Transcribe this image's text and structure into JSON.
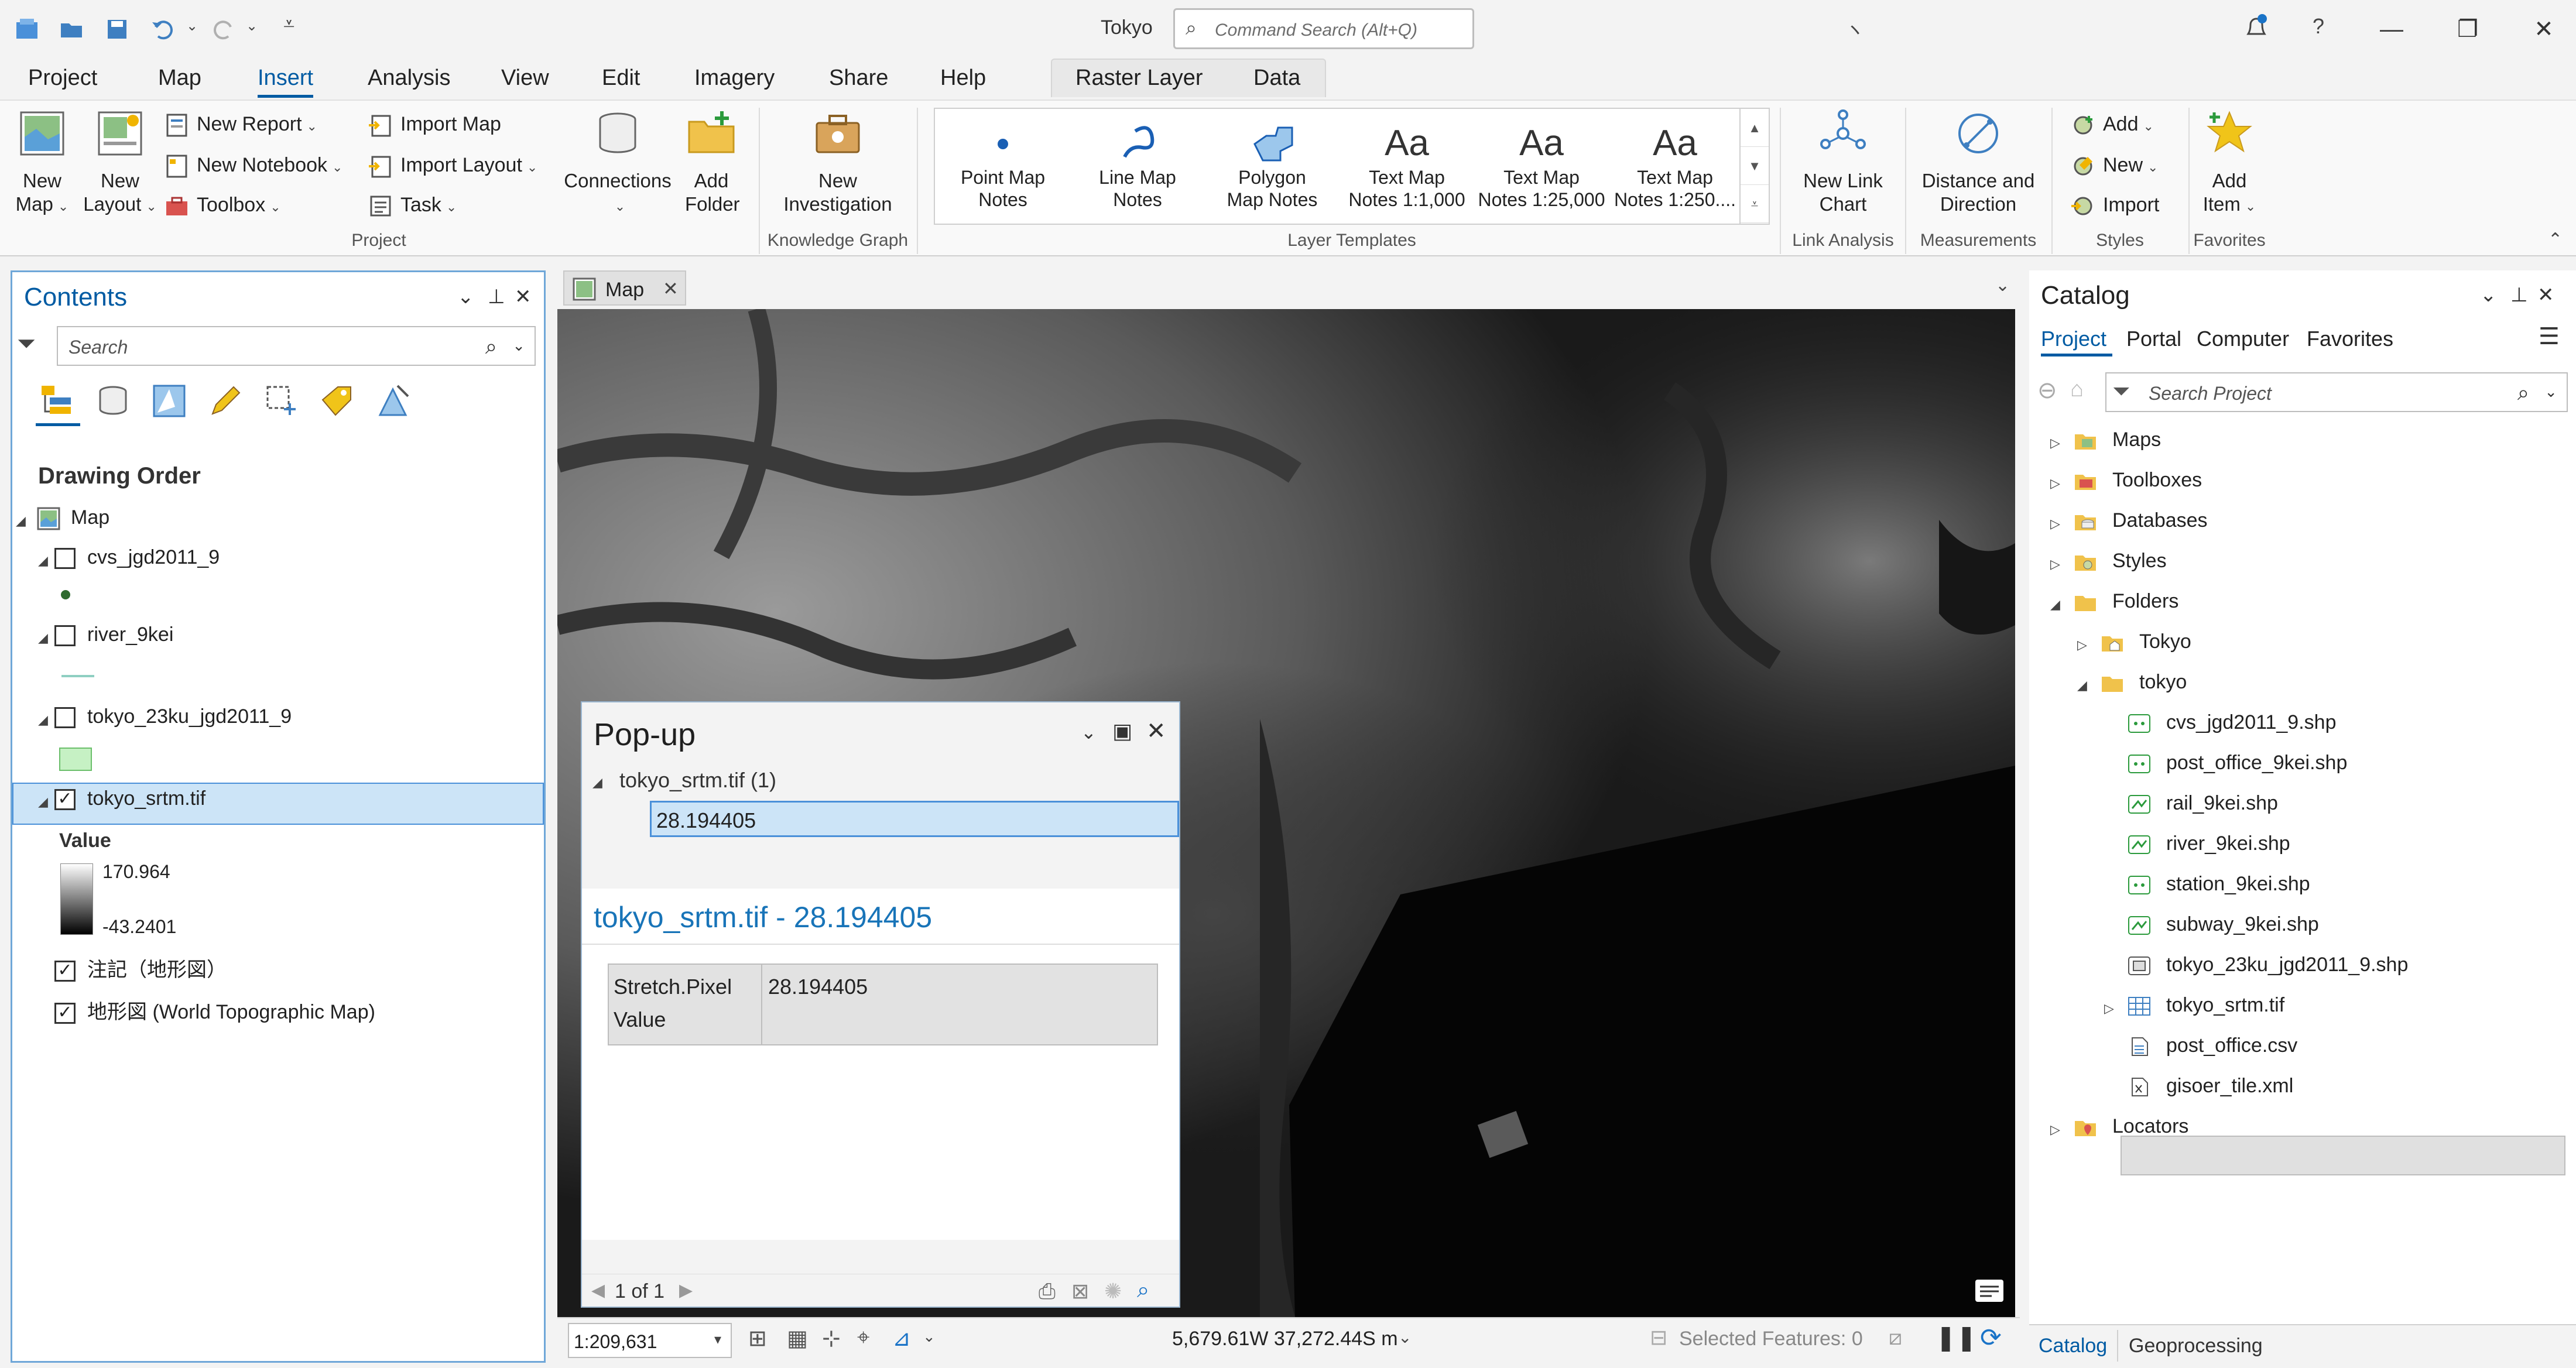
{
  "app": {
    "title": "Tokyo",
    "command_search_placeholder": "Command Search (Alt+Q)",
    "win_minimize": "—",
    "win_restore": "❐",
    "win_close": "✕",
    "title_glyph": "ヽ"
  },
  "ribbon_tabs": [
    "Project",
    "Map",
    "Insert",
    "Analysis",
    "View",
    "Edit",
    "Imagery",
    "Share",
    "Help"
  ],
  "ribbon_active_tab": "Insert",
  "context_tabs": [
    "Raster Layer",
    "Data"
  ],
  "ribbon": {
    "project": {
      "label": "Project",
      "new_map": [
        "New",
        "Map"
      ],
      "new_layout": [
        "New",
        "Layout"
      ],
      "new_report": "New Report",
      "new_notebook": "New Notebook",
      "toolbox": "Toolbox",
      "import_map": "Import Map",
      "import_layout": "Import Layout",
      "task": "Task",
      "connections": "Connections",
      "add_folder": [
        "Add",
        "Folder"
      ]
    },
    "knowledge_graph": {
      "label": "Knowledge Graph",
      "new_investigation": [
        "New",
        "Investigation"
      ]
    },
    "layer_templates": {
      "label": "Layer Templates",
      "items": [
        [
          "Point Map",
          "Notes"
        ],
        [
          "Line Map",
          "Notes"
        ],
        [
          "Polygon",
          "Map Notes"
        ],
        [
          "Text Map",
          "Notes 1:1,000"
        ],
        [
          "Text Map",
          "Notes 1:25,000"
        ],
        [
          "Text Map",
          "Notes 1:250...."
        ]
      ],
      "text_glyph": "Aa"
    },
    "link_analysis": {
      "label": "Link Analysis",
      "new_link_chart": [
        "New Link",
        "Chart"
      ]
    },
    "measurements": {
      "label": "Measurements",
      "distance_direction": [
        "Distance and",
        "Direction"
      ]
    },
    "styles": {
      "label": "Styles",
      "add": "Add",
      "new": "New",
      "import": "Import"
    },
    "favorites": {
      "label": "Favorites",
      "add_item": [
        "Add",
        "Item"
      ]
    }
  },
  "contents": {
    "title": "Contents",
    "search_placeholder": "Search",
    "section": "Drawing Order",
    "map_label": "Map",
    "layers": [
      {
        "name": "cvs_jgd2011_9",
        "checked": false
      },
      {
        "name": "river_9kei",
        "checked": false
      },
      {
        "name": "tokyo_23ku_jgd2011_9",
        "checked": false
      },
      {
        "name": "tokyo_srtm.tif",
        "checked": true
      }
    ],
    "value_label": "Value",
    "value_high": "170.964",
    "value_low": "-43.2401",
    "basemaps": [
      {
        "name": "注記（地形図）",
        "checked": true
      },
      {
        "name": "地形図 (World Topographic Map)",
        "checked": true
      }
    ]
  },
  "map": {
    "tab_label": "Map",
    "scale": "1:209,631",
    "coordinates": "5,679.61W 37,272.44S m",
    "selected_features": "Selected Features: 0"
  },
  "popup": {
    "title": "Pop-up",
    "layer_node": "tokyo_srtm.tif (1)",
    "selected_value": "28.194405",
    "heading": "tokyo_srtm.tif - 28.194405",
    "field_name_1": "Stretch.Pixel",
    "field_name_2": "Value",
    "field_value": "28.194405",
    "pager": "1 of 1"
  },
  "catalog": {
    "title": "Catalog",
    "tabs": [
      "Project",
      "Portal",
      "Computer",
      "Favorites"
    ],
    "search_placeholder": "Search Project",
    "items": [
      {
        "label": "Maps",
        "indent": 0,
        "expander": "▷",
        "icon": "maps"
      },
      {
        "label": "Toolboxes",
        "indent": 0,
        "expander": "▷",
        "icon": "toolbox"
      },
      {
        "label": "Databases",
        "indent": 0,
        "expander": "▷",
        "icon": "database"
      },
      {
        "label": "Styles",
        "indent": 0,
        "expander": "▷",
        "icon": "styles"
      },
      {
        "label": "Folders",
        "indent": 0,
        "expander": "◢",
        "icon": "folder"
      },
      {
        "label": "Tokyo",
        "indent": 1,
        "expander": "▷",
        "icon": "folder-home"
      },
      {
        "label": "tokyo",
        "indent": 1,
        "expander": "◢",
        "icon": "folder"
      },
      {
        "label": "cvs_jgd2011_9.shp",
        "indent": 2,
        "expander": "",
        "icon": "point-shp"
      },
      {
        "label": "post_office_9kei.shp",
        "indent": 2,
        "expander": "",
        "icon": "point-shp"
      },
      {
        "label": "rail_9kei.shp",
        "indent": 2,
        "expander": "",
        "icon": "line-shp"
      },
      {
        "label": "river_9kei.shp",
        "indent": 2,
        "expander": "",
        "icon": "line-shp"
      },
      {
        "label": "station_9kei.shp",
        "indent": 2,
        "expander": "",
        "icon": "point-shp"
      },
      {
        "label": "subway_9kei.shp",
        "indent": 2,
        "expander": "",
        "icon": "line-shp"
      },
      {
        "label": "tokyo_23ku_jgd2011_9.shp",
        "indent": 2,
        "expander": "",
        "icon": "polygon-shp"
      },
      {
        "label": "tokyo_srtm.tif",
        "indent": 2,
        "expander": "▷",
        "icon": "raster",
        "selected": true
      },
      {
        "label": "post_office.csv",
        "indent": 2,
        "expander": "",
        "icon": "table"
      },
      {
        "label": "gisoer_tile.xml",
        "indent": 2,
        "expander": "",
        "icon": "xml"
      },
      {
        "label": "Locators",
        "indent": 0,
        "expander": "▷",
        "icon": "locator"
      }
    ],
    "bottom_tabs": [
      "Catalog",
      "Geoprocessing"
    ]
  },
  "colors": {
    "accent": "#005ba3",
    "selection": "#cce4f7",
    "pane_border": "#6fa7d8",
    "map_bg": "#0a0a0a"
  }
}
